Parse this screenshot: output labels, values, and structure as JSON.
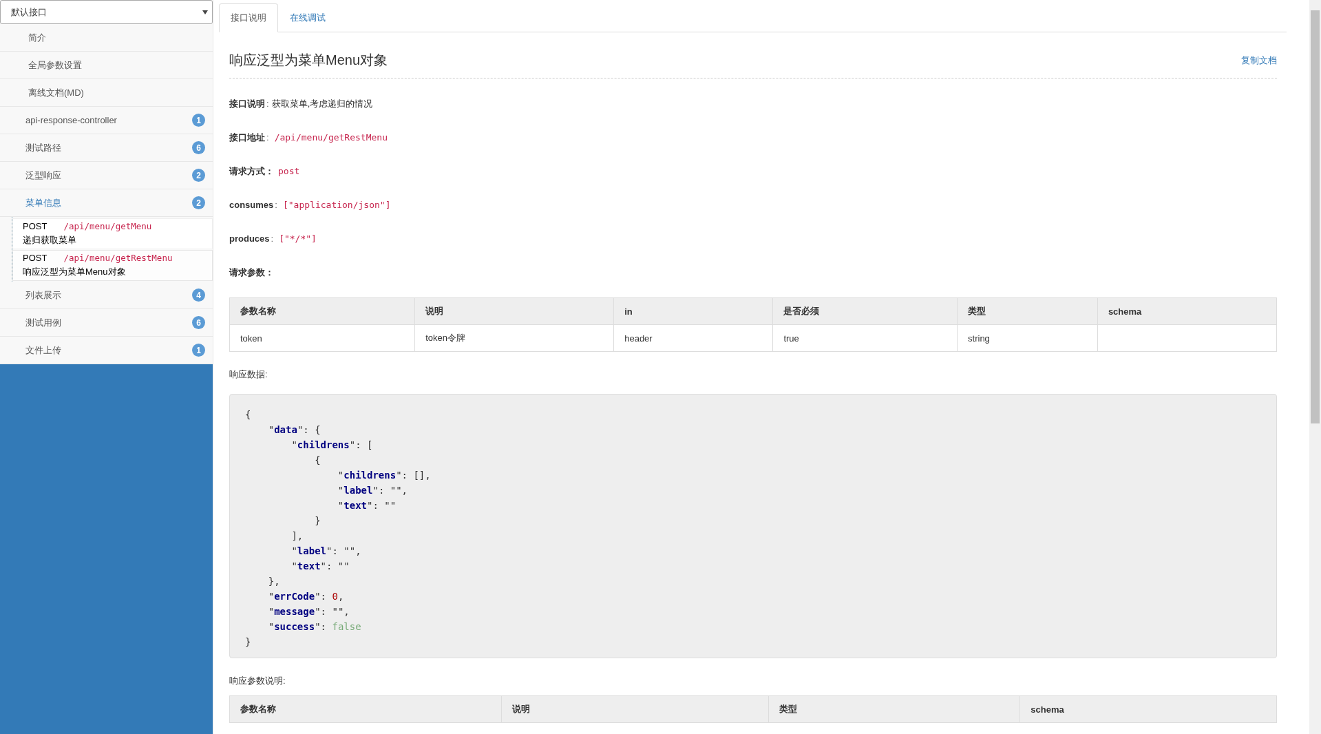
{
  "sidebar": {
    "group_select": {
      "value": "默认接口"
    },
    "items": [
      {
        "kind": "page",
        "label": "简介",
        "expanded": false
      },
      {
        "kind": "page",
        "label": "全局参数设置",
        "expanded": false
      },
      {
        "kind": "page",
        "label": "离线文档(MD)",
        "expanded": false
      },
      {
        "kind": "group",
        "label": "api-response-controller",
        "count": "1",
        "expanded": false
      },
      {
        "kind": "group",
        "label": "测试路径",
        "count": "6",
        "expanded": false
      },
      {
        "kind": "group",
        "label": "泛型响应",
        "count": "2",
        "expanded": false
      },
      {
        "kind": "group",
        "label": "菜单信息",
        "count": "2",
        "expanded": true,
        "children": [
          {
            "method": "POST",
            "path": "/api/menu/getMenu",
            "summary": "递归获取菜单",
            "selected": false
          },
          {
            "method": "POST",
            "path": "/api/menu/getRestMenu",
            "summary": "响应泛型为菜单Menu对象",
            "selected": true
          }
        ]
      },
      {
        "kind": "group",
        "label": "列表展示",
        "count": "4",
        "expanded": false
      },
      {
        "kind": "group",
        "label": "测试用例",
        "count": "6",
        "expanded": false
      },
      {
        "kind": "group",
        "label": "文件上传",
        "count": "1",
        "expanded": false
      }
    ]
  },
  "tabs": [
    {
      "label": "接口说明",
      "selected": true
    },
    {
      "label": "在线调试",
      "selected": false
    }
  ],
  "doc": {
    "title": "响应泛型为菜单Menu对象",
    "copy_link": "复制文档",
    "fields": [
      {
        "kind": "text",
        "label": "接口说明",
        "sep": ":",
        "value": "获取菜单,考虑递归的情况"
      },
      {
        "kind": "code",
        "label": "接口地址",
        "sep": ":",
        "value": "/api/menu/getRestMenu"
      },
      {
        "kind": "code",
        "label": "请求方式：",
        "value": "post"
      },
      {
        "kind": "code",
        "label": "consumes",
        "sep": ":",
        "value": "[\"application/json\"]"
      },
      {
        "kind": "code",
        "label": "produces",
        "sep": ":",
        "value": "[\"*/*\"]"
      },
      {
        "kind": "heading",
        "label": "请求参数："
      }
    ],
    "request_table": {
      "columns": [
        "参数名称",
        "说明",
        "in",
        "是否必须",
        "类型",
        "schema"
      ],
      "rows": [
        [
          "token",
          "token令牌",
          "header",
          "true",
          "string",
          ""
        ]
      ]
    },
    "response_label": "响应数据:",
    "response_code": [
      [
        {
          "kind": "punct",
          "text": "{"
        }
      ],
      [
        {
          "kind": "punct",
          "text": "    \""
        },
        {
          "kind": "key",
          "text": "data"
        },
        {
          "kind": "punct",
          "text": "\": {"
        }
      ],
      [
        {
          "kind": "punct",
          "text": "        \""
        },
        {
          "kind": "key",
          "text": "childrens"
        },
        {
          "kind": "punct",
          "text": "\": ["
        }
      ],
      [
        {
          "kind": "punct",
          "text": "            {"
        }
      ],
      [
        {
          "kind": "punct",
          "text": "                \""
        },
        {
          "kind": "key",
          "text": "childrens"
        },
        {
          "kind": "punct",
          "text": "\": [],"
        }
      ],
      [
        {
          "kind": "punct",
          "text": "                \""
        },
        {
          "kind": "key",
          "text": "label"
        },
        {
          "kind": "punct",
          "text": "\": \"\","
        }
      ],
      [
        {
          "kind": "punct",
          "text": "                \""
        },
        {
          "kind": "key",
          "text": "text"
        },
        {
          "kind": "punct",
          "text": "\": \"\""
        }
      ],
      [
        {
          "kind": "punct",
          "text": "            }"
        }
      ],
      [
        {
          "kind": "punct",
          "text": "        ],"
        }
      ],
      [
        {
          "kind": "punct",
          "text": "        \""
        },
        {
          "kind": "key",
          "text": "label"
        },
        {
          "kind": "punct",
          "text": "\": \"\","
        }
      ],
      [
        {
          "kind": "punct",
          "text": "        \""
        },
        {
          "kind": "key",
          "text": "text"
        },
        {
          "kind": "punct",
          "text": "\": \"\""
        }
      ],
      [
        {
          "kind": "punct",
          "text": "    },"
        }
      ],
      [
        {
          "kind": "punct",
          "text": "    \""
        },
        {
          "kind": "key",
          "text": "errCode"
        },
        {
          "kind": "punct",
          "text": "\": "
        },
        {
          "kind": "number",
          "text": "0"
        },
        {
          "kind": "punct",
          "text": ","
        }
      ],
      [
        {
          "kind": "punct",
          "text": "    \""
        },
        {
          "kind": "key",
          "text": "message"
        },
        {
          "kind": "punct",
          "text": "\": \"\","
        }
      ],
      [
        {
          "kind": "punct",
          "text": "    \""
        },
        {
          "kind": "key",
          "text": "success"
        },
        {
          "kind": "punct",
          "text": "\": "
        },
        {
          "kind": "bool",
          "text": "false"
        }
      ],
      [
        {
          "kind": "punct",
          "text": "}"
        }
      ]
    ],
    "response_params_label": "响应参数说明:",
    "response_table": {
      "columns": [
        "参数名称",
        "说明",
        "类型",
        "schema"
      ]
    }
  }
}
